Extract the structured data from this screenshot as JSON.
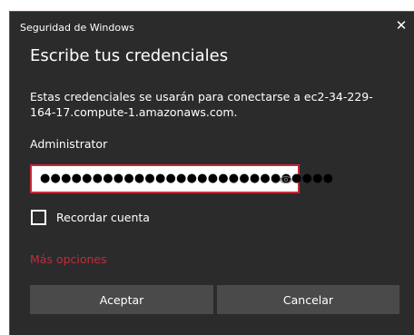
{
  "window": {
    "title": "Seguridad de Windows",
    "close_glyph": "✕"
  },
  "dialog": {
    "heading": "Escribe tus credenciales",
    "message": "Estas credenciales se usarán para conectarse a ec2-34-229-164-17.compute-1.amazonaws.com.",
    "username": "Administrator",
    "password_masked": "●●●●●●●●●●●●●●●●●●●●●●●●●●●●",
    "remember_label": "Recordar cuenta",
    "remember_checked": false,
    "more_options_label": "Más opciones",
    "ok_label": "Aceptar",
    "cancel_label": "Cancelar"
  },
  "colors": {
    "dialog_bg": "#2b2b2b",
    "accent_red": "#c62a3a",
    "button_bg": "#4a4a4a",
    "text": "#ffffff"
  },
  "icons": {
    "close": "close-icon",
    "reveal_password": "eye-icon"
  }
}
